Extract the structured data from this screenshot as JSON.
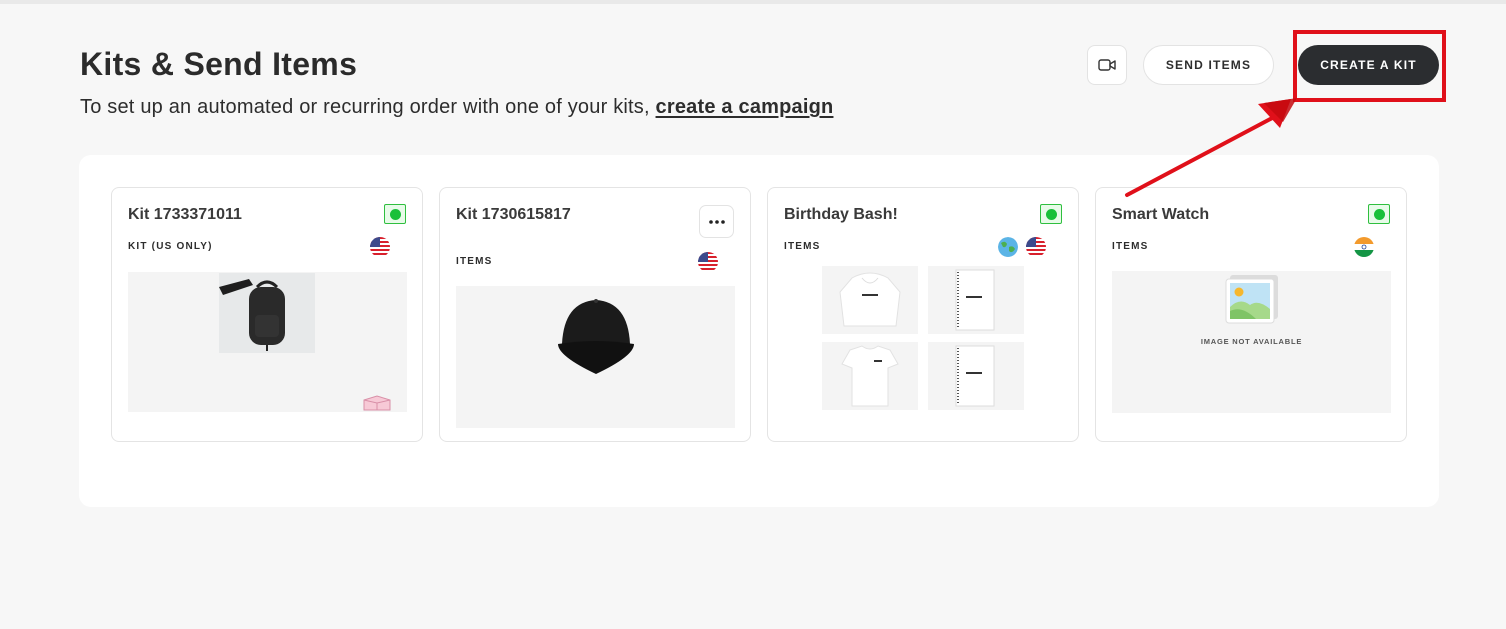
{
  "header": {
    "title": "Kits & Send Items",
    "subtitle_prefix": "To set up an automated or recurring order with one of your kits,",
    "subtitle_link": "create a campaign",
    "video_icon": "video-camera-icon",
    "send_items_label": "SEND ITEMS",
    "create_kit_label": "CREATE A KIT"
  },
  "annotation": {
    "highlight_color": "#e0101a"
  },
  "kits": [
    {
      "name": "Kit 1733371011",
      "type": "KIT (US ONLY)",
      "status": "active",
      "flags": [
        "us-flag-icon"
      ],
      "image": "black-backpack"
    },
    {
      "name": "Kit 1730615817",
      "type": "ITEMS",
      "flags": [
        "us-flag-icon"
      ],
      "image": "black-cap",
      "menu_icon": "more-horizontal-icon"
    },
    {
      "name": "Birthday Bash!",
      "type": "ITEMS",
      "status": "active",
      "flags": [
        "globe-icon",
        "us-flag-icon"
      ],
      "images": [
        "white-hoodie",
        "notebook",
        "white-tshirt",
        "notebook"
      ]
    },
    {
      "name": "Smart Watch",
      "type": "ITEMS",
      "status": "active",
      "flags": [
        "india-flag-icon"
      ],
      "image": "placeholder",
      "image_text": "IMAGE NOT AVAILABLE"
    }
  ],
  "colors": {
    "primary_button": "#2b2d30",
    "status_green": "#19c039"
  }
}
